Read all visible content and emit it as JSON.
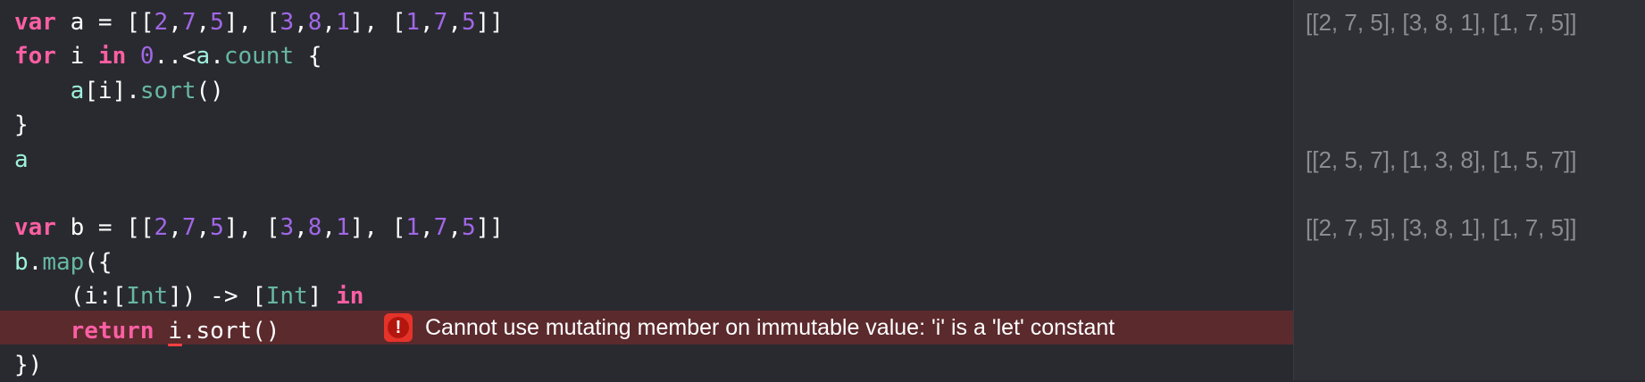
{
  "editor": {
    "lines": [
      {
        "tokens": [
          {
            "t": "var",
            "c": "kw"
          },
          {
            "t": " a = [[",
            "c": "plain"
          },
          {
            "t": "2",
            "c": "num num-purple"
          },
          {
            "t": ",",
            "c": "plain"
          },
          {
            "t": "7",
            "c": "num num-purple"
          },
          {
            "t": ",",
            "c": "plain"
          },
          {
            "t": "5",
            "c": "num num-purple"
          },
          {
            "t": "], [",
            "c": "plain"
          },
          {
            "t": "3",
            "c": "num num-purple"
          },
          {
            "t": ",",
            "c": "plain"
          },
          {
            "t": "8",
            "c": "num num-purple"
          },
          {
            "t": ",",
            "c": "plain"
          },
          {
            "t": "1",
            "c": "num num-purple"
          },
          {
            "t": "], [",
            "c": "plain"
          },
          {
            "t": "1",
            "c": "num num-purple"
          },
          {
            "t": ",",
            "c": "plain"
          },
          {
            "t": "7",
            "c": "num num-purple"
          },
          {
            "t": ",",
            "c": "plain"
          },
          {
            "t": "5",
            "c": "num num-purple"
          },
          {
            "t": "]]",
            "c": "plain"
          }
        ]
      },
      {
        "tokens": [
          {
            "t": "for",
            "c": "kw"
          },
          {
            "t": " i ",
            "c": "plain"
          },
          {
            "t": "in",
            "c": "kw"
          },
          {
            "t": " ",
            "c": "plain"
          },
          {
            "t": "0",
            "c": "num num-purple"
          },
          {
            "t": "..<",
            "c": "plain"
          },
          {
            "t": "a",
            "c": "var"
          },
          {
            "t": ".",
            "c": "plain"
          },
          {
            "t": "count",
            "c": "prop"
          },
          {
            "t": " {",
            "c": "plain"
          }
        ]
      },
      {
        "tokens": [
          {
            "t": "    ",
            "c": "plain"
          },
          {
            "t": "a",
            "c": "var"
          },
          {
            "t": "[i].",
            "c": "plain"
          },
          {
            "t": "sort",
            "c": "prop"
          },
          {
            "t": "()",
            "c": "plain"
          }
        ]
      },
      {
        "tokens": [
          {
            "t": "}",
            "c": "plain"
          }
        ]
      },
      {
        "tokens": [
          {
            "t": "a",
            "c": "var"
          }
        ]
      },
      {
        "tokens": []
      },
      {
        "tokens": [
          {
            "t": "var",
            "c": "kw"
          },
          {
            "t": " b = [[",
            "c": "plain"
          },
          {
            "t": "2",
            "c": "num num-purple"
          },
          {
            "t": ",",
            "c": "plain"
          },
          {
            "t": "7",
            "c": "num num-purple"
          },
          {
            "t": ",",
            "c": "plain"
          },
          {
            "t": "5",
            "c": "num num-purple"
          },
          {
            "t": "], [",
            "c": "plain"
          },
          {
            "t": "3",
            "c": "num num-purple"
          },
          {
            "t": ",",
            "c": "plain"
          },
          {
            "t": "8",
            "c": "num num-purple"
          },
          {
            "t": ",",
            "c": "plain"
          },
          {
            "t": "1",
            "c": "num num-purple"
          },
          {
            "t": "], [",
            "c": "plain"
          },
          {
            "t": "1",
            "c": "num num-purple"
          },
          {
            "t": ",",
            "c": "plain"
          },
          {
            "t": "7",
            "c": "num num-purple"
          },
          {
            "t": ",",
            "c": "plain"
          },
          {
            "t": "5",
            "c": "num num-purple"
          },
          {
            "t": "]]",
            "c": "plain"
          }
        ]
      },
      {
        "tokens": [
          {
            "t": "b",
            "c": "var"
          },
          {
            "t": ".",
            "c": "plain"
          },
          {
            "t": "map",
            "c": "prop"
          },
          {
            "t": "({",
            "c": "plain"
          }
        ]
      },
      {
        "tokens": [
          {
            "t": "    (i:[",
            "c": "plain"
          },
          {
            "t": "Int",
            "c": "prop"
          },
          {
            "t": "]) -> [",
            "c": "plain"
          },
          {
            "t": "Int",
            "c": "prop"
          },
          {
            "t": "] ",
            "c": "plain"
          },
          {
            "t": "in",
            "c": "kw"
          }
        ]
      },
      {
        "tokens": [
          {
            "t": "    ",
            "c": "plain"
          },
          {
            "t": "return",
            "c": "kw"
          },
          {
            "t": " ",
            "c": "plain"
          },
          {
            "t": "i",
            "c": "plain underline-err"
          },
          {
            "t": ".sort()",
            "c": "plain"
          }
        ]
      },
      {
        "tokens": [
          {
            "t": "})",
            "c": "plain"
          }
        ]
      }
    ]
  },
  "error": {
    "icon": "exclamation-icon",
    "message": "Cannot use mutating member on immutable value: 'i' is a 'let' constant"
  },
  "results": [
    {
      "line": 1,
      "text": "[[2, 7, 5], [3, 8, 1], [1, 7, 5]]"
    },
    {
      "line": 5,
      "text": "[[2, 5, 7], [1, 3, 8], [1, 5, 7]]"
    },
    {
      "line": 7,
      "text": "[[2, 7, 5], [3, 8, 1], [1, 7, 5]]"
    }
  ],
  "colors": {
    "editor_bg": "#292a30",
    "results_bg": "#2f3035",
    "error_band": "#5b2a2d",
    "keyword": "#fc5fa3",
    "number": "#a167e6",
    "error_icon": "#e5332a"
  }
}
